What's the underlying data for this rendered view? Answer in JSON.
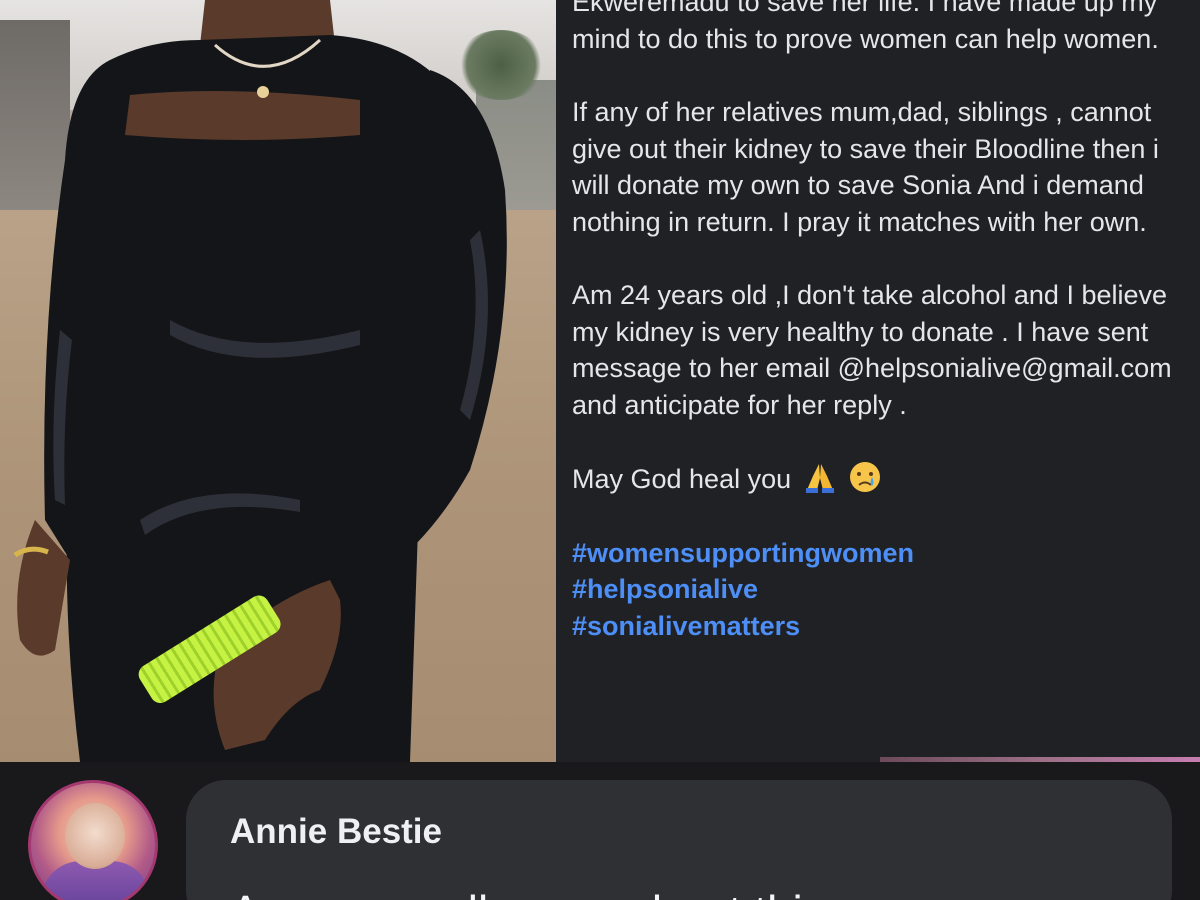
{
  "post": {
    "paragraphs": [
      "Ekweremadu to save her life. I have made up my mind to do this to prove women can help women.",
      "If any of her relatives mum,dad, siblings , cannot give out their kidney to save their Bloodline then i will donate my own to save Sonia And i demand nothing in return. I pray it matches with her own.",
      "Am 24 years old ,I don't take alcohol and  I believe my kidney is very healthy to donate . I have sent message to her email @helpsonialive@gmail.com and anticipate for her reply ."
    ],
    "blessing": "May God heal you",
    "blessing_emojis": [
      "folded-hands-emoji",
      "crying-face-emoji"
    ],
    "hashtags": [
      "#womensupportingwomen",
      "#helpsonialive",
      "#sonialivematters"
    ]
  },
  "comment": {
    "author": "Annie Bestie",
    "text": "Are you really sure about this or you"
  },
  "colors": {
    "hashtag": "#4d8ff6",
    "panel_bg": "#202124",
    "bubble_bg": "#2f3033"
  }
}
